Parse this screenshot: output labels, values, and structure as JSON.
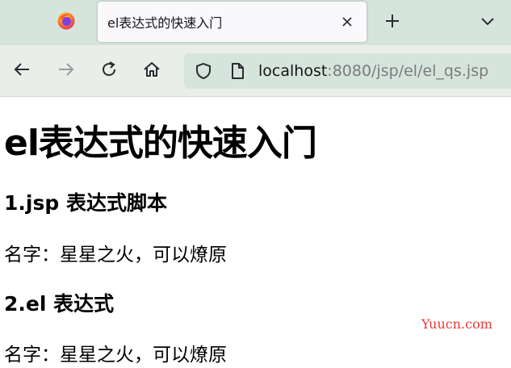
{
  "browser": {
    "tab": {
      "title": "el表达式的快速入门"
    },
    "icons": {
      "app": "firefox-logo-icon",
      "close": "close-icon",
      "new_tab": "plus-icon",
      "tab_list": "chevron-down-icon",
      "back": "arrow-left-icon",
      "forward": "arrow-right-icon",
      "reload": "reload-icon",
      "home": "home-icon",
      "tracking": "shield-icon",
      "page_info": "page-icon"
    },
    "url": {
      "host": "localhost",
      "rest": ":8080/jsp/el/el_qs.jsp"
    }
  },
  "page": {
    "heading": "el表达式的快速入门",
    "section1": {
      "title": "1.jsp 表达式脚本",
      "text": "名字：星星之火，可以燎原"
    },
    "section2": {
      "title": "2.el 表达式",
      "text": "名字：星星之火，可以燎原"
    },
    "watermark": "Yuucn.com"
  },
  "colors": {
    "tabstrip": "#d6e5dc",
    "navbar": "#e9eee9",
    "watermark": "#e53935"
  }
}
